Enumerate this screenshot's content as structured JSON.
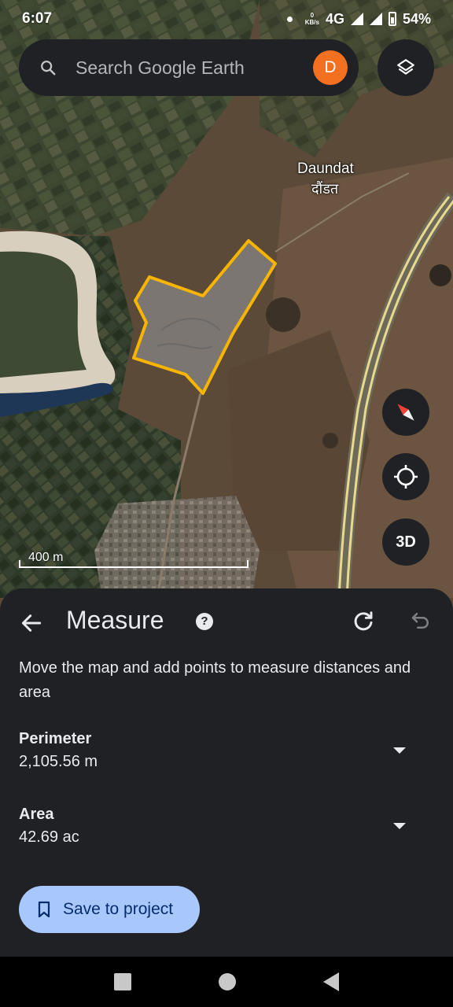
{
  "status_bar": {
    "time": "6:07",
    "net_speed_value": "0",
    "net_speed_unit": "KB/s",
    "network": "4G",
    "battery": "54%"
  },
  "search": {
    "placeholder": "Search Google Earth",
    "avatar_letter": "D",
    "avatar_color": "#f37021"
  },
  "map": {
    "place_name": "Daundat",
    "place_name_local": "दौंडत",
    "scale_label": "400 m",
    "btn_3d": "3D",
    "polygon_color": "#f7b500"
  },
  "measure_panel": {
    "title": "Measure",
    "help_icon": "?",
    "description": "Move the map and add points to measure distances and area",
    "metrics": [
      {
        "label": "Perimeter",
        "value": "2,105.56 m"
      },
      {
        "label": "Area",
        "value": "42.69 ac"
      }
    ],
    "save_button": "Save to project",
    "save_button_color": "#a8c7fa"
  },
  "icons": {
    "search": "search-icon",
    "layers": "layers-icon",
    "compass": "compass-icon",
    "location": "my-location-icon",
    "back": "arrow-back-icon",
    "redo": "redo-icon",
    "undo": "undo-icon",
    "bookmark": "bookmark-icon"
  }
}
